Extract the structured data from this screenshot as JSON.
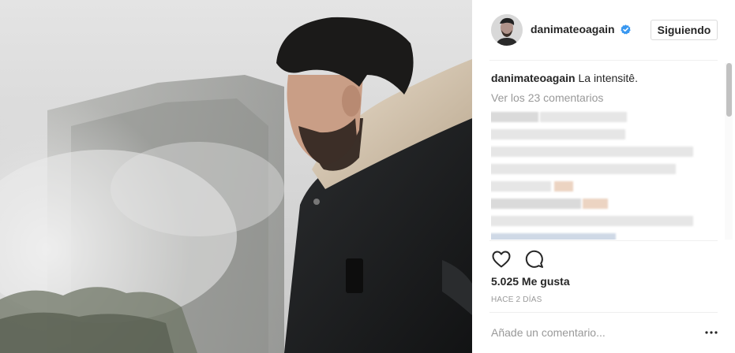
{
  "post": {
    "username": "danimateoagain",
    "verified": true,
    "follow_label": "Siguiendo",
    "caption_user": "danimateoagain",
    "caption_text": " La intensitê.",
    "view_comments": "Ver los 23 comentarios",
    "likes": "5.025 Me gusta",
    "time_ago": "HACE 2 DÍAS",
    "add_comment_placeholder": "Añade un comentario...",
    "more_label": "•••"
  },
  "icons": {
    "like": "heart-icon",
    "comment": "comment-icon",
    "verified": "verified-badge-icon",
    "more": "more-options-icon"
  },
  "colors": {
    "verified_blue": "#3897f0",
    "text": "#262626",
    "muted": "#999999",
    "border": "#dbdbdb"
  }
}
